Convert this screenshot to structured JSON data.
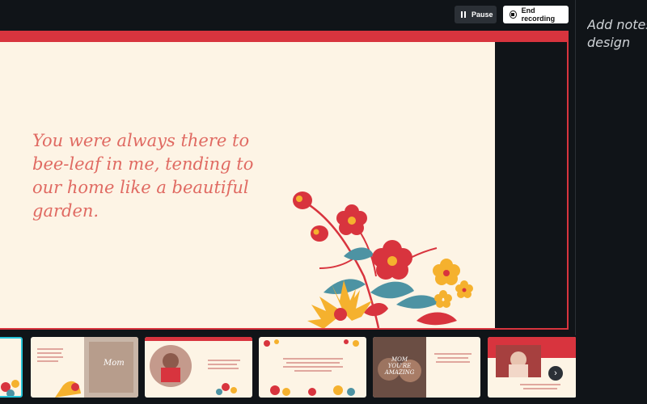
{
  "toolbar": {
    "pause_label": "Pause",
    "end_recording_label": "End recording"
  },
  "notes_panel": {
    "placeholder_line1": "Add notes",
    "placeholder_line2": "design"
  },
  "slide": {
    "quote_line1": "You were always there to",
    "quote_line2": "bee-leaf in me, tending to",
    "quote_line3": "our home like a beautiful",
    "quote_line4": "garden."
  },
  "filmstrip": {
    "thumb2_script": "Mom",
    "thumb6_script": "MOM YOU'RE AMAZING"
  },
  "colors": {
    "accent_red": "#d8343e",
    "slide_bg": "#fdf4e5",
    "quote_color": "#e06a62",
    "active_thumb_border": "#26c3d8"
  }
}
